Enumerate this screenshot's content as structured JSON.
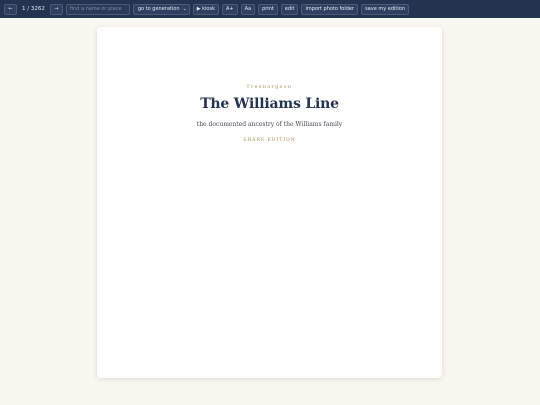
{
  "toolbar": {
    "prev_label": "←",
    "page_counter": "1 / 3262",
    "next_label": "→",
    "search_placeholder": "find a name or place",
    "generation_select": "go to generation",
    "kiosk_label": "▶ kiosk",
    "font_bigger_label": "A+",
    "font_style_label": "Aa",
    "print_label": "print",
    "edit_label": "edit",
    "import_label": "import photo folder",
    "save_label": "save my edition"
  },
  "page": {
    "eyebrow": "Treeborgoon",
    "title": "The Williams Line",
    "subtitle": "the documented ancestry of the Williams family",
    "share_label": "SHARE EDITION"
  },
  "colors": {
    "toolbar_bg": "#233350",
    "page_bg": "#faf7f0",
    "accent_gold": "#b08a4a",
    "title_navy": "#233350"
  }
}
